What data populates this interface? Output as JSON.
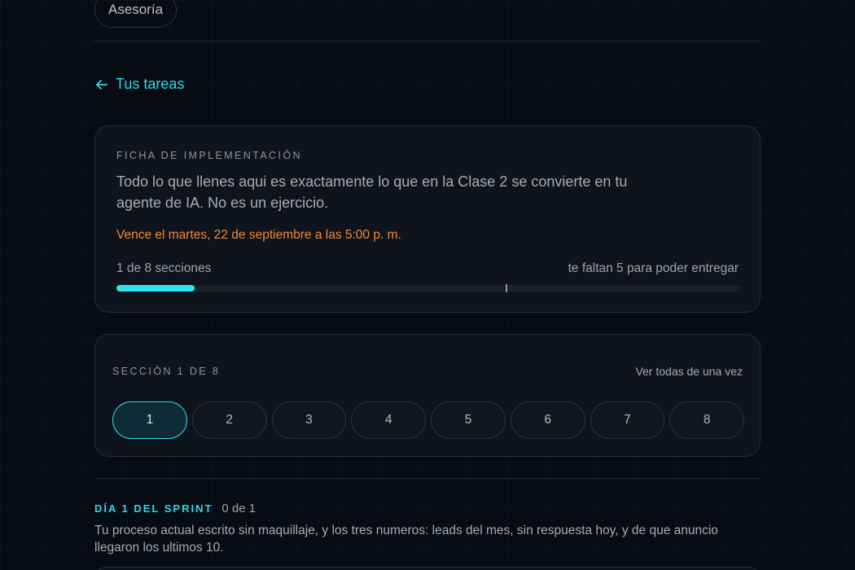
{
  "top_pill": {
    "label": "Asesoría"
  },
  "back_link": {
    "label": "Tus tareas",
    "icon": "arrow-left-icon"
  },
  "assignment": {
    "eyebrow": "FICHA DE IMPLEMENTACIÓN",
    "description": "Todo lo que llenes aqui es exactamente lo que en la Clase 2 se convierte en tu agente de IA. No es un ejercicio.",
    "due": "Vence el martes, 22 de septiembre a las 5:00 p. m.",
    "progress_left": "1 de 8 secciones",
    "progress_right": "te faltan 5 para poder entregar",
    "progress_fraction": 0.125,
    "required_fraction": 0.625,
    "accent_color": "#2ee3ef",
    "due_color": "#f08b34"
  },
  "sections": {
    "eyebrow": "SECCIÓN 1 DE 8",
    "view_all": "Ver todas de una vez",
    "tabs": [
      "1",
      "2",
      "3",
      "4",
      "5",
      "6",
      "7",
      "8"
    ],
    "active_index": 0
  },
  "sprint": {
    "title": "DÍA 1 DEL SPRINT",
    "count": "0 de 1",
    "description": "Tu proceso actual escrito sin maquillaje, y los tres numeros: leads del mes, sin respuesta hoy, y de que anuncio llegaron los ultimos 10."
  }
}
